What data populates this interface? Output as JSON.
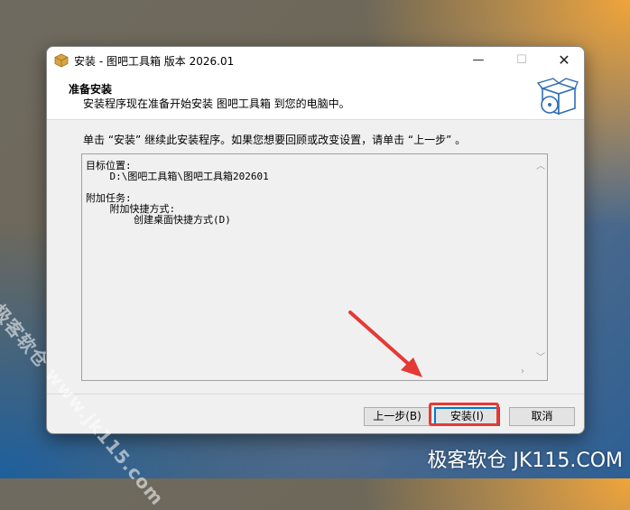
{
  "window": {
    "title": "安装 - 图吧工具箱 版本 2026.01",
    "minimize_glyph": "—",
    "maximize_glyph": "☐",
    "close_glyph": "✕"
  },
  "header": {
    "title": "准备安装",
    "subtitle": "安装程序现在准备开始安装 图吧工具箱 到您的电脑中。"
  },
  "instruction": "单击 “安装” 继续此安装程序。如果您想要回顾或改变设置，请单击 “上一步” 。",
  "memo": {
    "lines": [
      "目标位置:",
      "    D:\\图吧工具箱\\图吧工具箱202601",
      "",
      "附加任务:",
      "    附加快捷方式:",
      "        创建桌面快捷方式(D)"
    ]
  },
  "buttons": {
    "back": "上一步(B)",
    "install": "安装(I)",
    "cancel": "取消"
  },
  "icons": [
    "app-icon",
    "minimize-icon",
    "maximize-icon",
    "close-icon",
    "box-icon",
    "scroll-up-icon",
    "scroll-down-icon",
    "scroll-right-icon"
  ],
  "watermark": {
    "diagonal": "极客软仓 www.jk115.com",
    "corner": "极客软仓 JK115.COM"
  },
  "colors": {
    "highlight": "#e53935",
    "focus": "#0078d7"
  }
}
